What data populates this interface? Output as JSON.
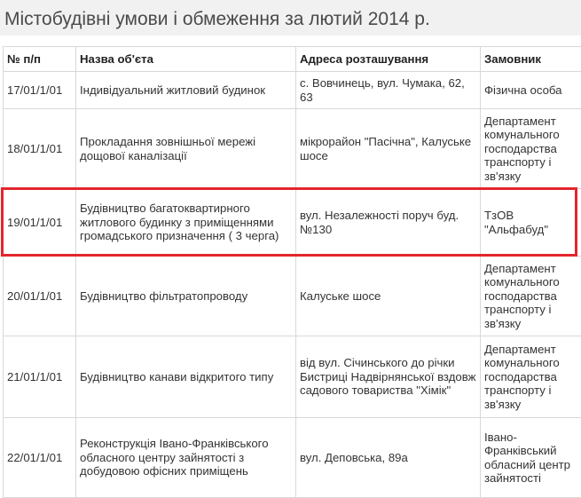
{
  "page": {
    "title": "Містобудівні умови і обмеження за лютий 2014 р."
  },
  "table": {
    "headers": [
      "№ п/п",
      "Назва об'єта",
      "Адреса розташування",
      "Замовник"
    ],
    "rows": [
      {
        "number": "17/01/1/01",
        "name": "Індивідуальний житловий будинок",
        "address": "с. Вовчинець, вул. Чумака, 62, 63",
        "customer": "Фізична особа"
      },
      {
        "number": "18/01/1/01",
        "name": "Прокладання зовнішньої мережі дощової каналізації",
        "address": "мікрорайон \"Пасічна\", Калуське шосе",
        "customer": "Департамент комунального господарства транспорту і зв'язку"
      },
      {
        "number": "19/01/1/01",
        "name": "Будівництво багатоквартирного житлового будинку з приміщеннями громадського призначення ( 3 черга)",
        "address": "вул. Незалежності поруч буд. №130",
        "customer": "ТзОВ \"Альфабуд\""
      },
      {
        "number": "20/01/1/01",
        "name": "Будівництво фільтратопроводу",
        "address": "Калуське шосе",
        "customer": "Департамент комунального господарства транспорту і зв'язку"
      },
      {
        "number": "21/01/1/01",
        "name": "Будівництво канави відкритого типу",
        "address": "від вул. Січинського до річки Бистриці Надвірнянської вздовж садового товариства \"Хімік\"",
        "customer": "Департамент комунального господарства транспорту і зв'язку"
      },
      {
        "number": "22/01/1/01",
        "name": "Реконструкція Івано-Франківського обласного центру зайнятості з добудовою офісних приміщень",
        "address": "вул. Деповська, 89а",
        "customer": "Івано-Франківський обласний центр зайнятості"
      }
    ]
  },
  "highlight": {
    "color": "#e3262d"
  }
}
